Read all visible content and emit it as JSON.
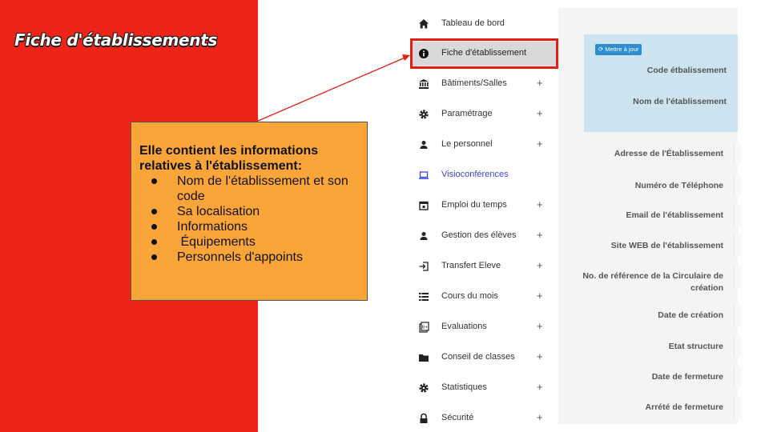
{
  "slide": {
    "title": "Fiche d'établissements",
    "panel_color": "#ee2418",
    "callout": {
      "heading": "Elle contient les informations relatives à l'établissement:",
      "items": [
        "Nom de l'établissement et son code",
        "Sa localisation",
        "Informations",
        " Équipements",
        "Personnels d'appoints"
      ],
      "color": "#f9a53a"
    },
    "highlight_color": "#e51d13"
  },
  "sidebar": {
    "items": [
      {
        "label": "Tableau de bord",
        "icon": "home-icon",
        "plus": ""
      },
      {
        "label": "Fiche d'établissement",
        "icon": "info-icon",
        "plus": "",
        "active": true
      },
      {
        "label": "Bâtiments/Salles",
        "icon": "bank-icon",
        "plus": "+"
      },
      {
        "label": "Paramétrage",
        "icon": "gear-icon",
        "plus": "+"
      },
      {
        "label": "Le personnel",
        "icon": "user-icon",
        "plus": "+"
      },
      {
        "label": "Visioconférences",
        "icon": "laptop-icon",
        "plus": ""
      },
      {
        "label": "Emploi du temps",
        "icon": "calendar-icon",
        "plus": "+"
      },
      {
        "label": "Gestion des élèves",
        "icon": "user-icon",
        "plus": "+"
      },
      {
        "label": "Transfert Eleve",
        "icon": "sign-in-icon",
        "plus": "+"
      },
      {
        "label": "Cours du mois",
        "icon": "list-icon",
        "plus": "+"
      },
      {
        "label": "Evaluations",
        "icon": "clipboard-icon",
        "plus": "+"
      },
      {
        "label": "Conseil de classes",
        "icon": "folder-icon",
        "plus": "+"
      },
      {
        "label": "Statistiques",
        "icon": "gear-icon",
        "plus": "+"
      },
      {
        "label": "Sécurité",
        "icon": "lock-icon",
        "plus": "+"
      }
    ],
    "link_color": "#3b46d6"
  },
  "form": {
    "update_button": "Mettre à jour",
    "card_fields": [
      "Code étbalissement",
      "Nom de l'établissement"
    ],
    "fields": [
      "Adresse de l'Établissement",
      "Numéro de Téléphone",
      "Email de l'établissement",
      "Site WEB de l'établissement",
      "No. de référence de la Circulaire de création",
      "Date de création",
      "Etat structure",
      "Date de fermeture",
      "Arrété de fermeture"
    ],
    "card_color": "#cde4f0",
    "button_color": "#2d8ecf"
  }
}
